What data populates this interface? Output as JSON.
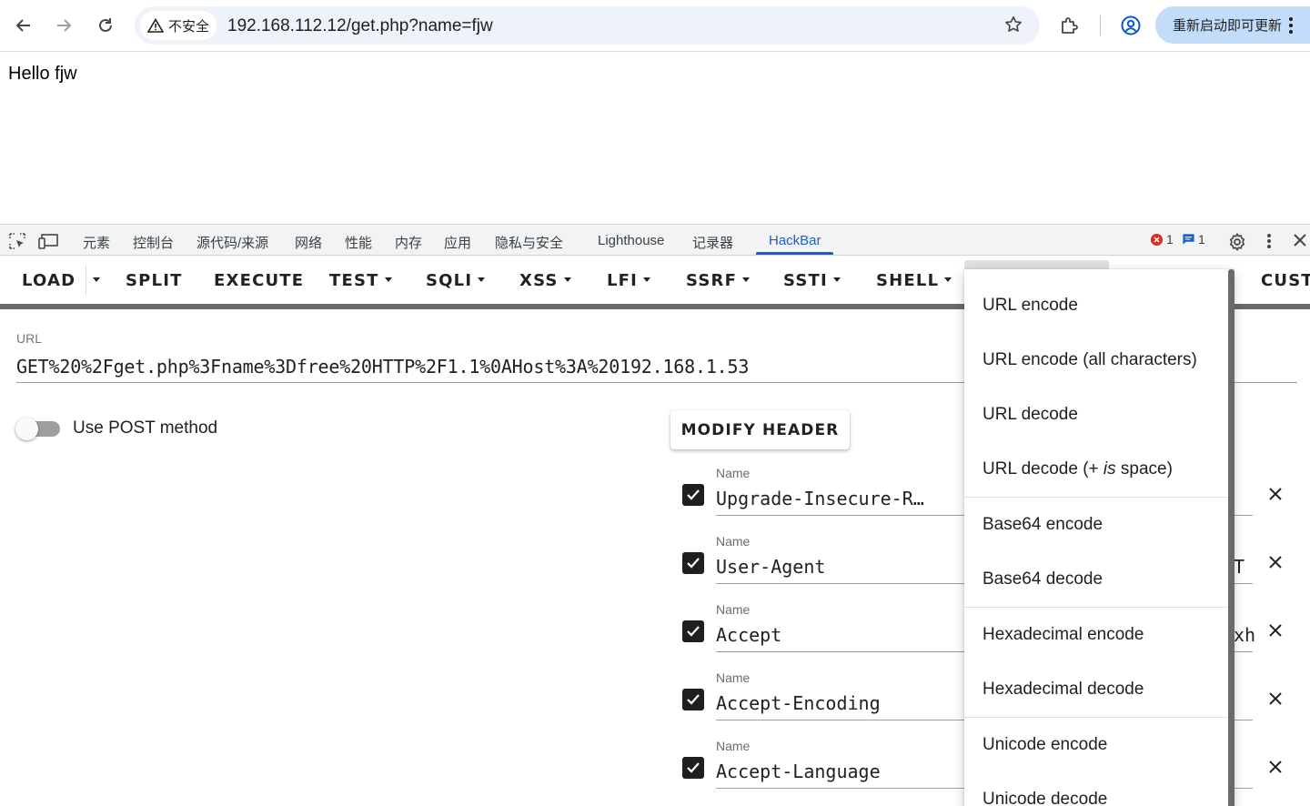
{
  "browser": {
    "security_label": "不安全",
    "url": "192.168.112.12/get.php?name=fjw",
    "update_label": "重新启动即可更新"
  },
  "page": {
    "body_text": "Hello fjw"
  },
  "devtools": {
    "tabs": [
      "元素",
      "控制台",
      "源代码/来源",
      "网络",
      "性能",
      "内存",
      "应用",
      "隐私与安全",
      "Lighthouse",
      "记录器",
      "HackBar"
    ],
    "active_tab": "HackBar",
    "error_count": "1",
    "message_count": "1"
  },
  "hackbar": {
    "menu": {
      "load": "LOAD",
      "split": "SPLIT",
      "execute": "EXECUTE",
      "test": "TEST",
      "sqli": "SQLI",
      "xss": "XSS",
      "lfi": "LFI",
      "ssrf": "SSRF",
      "ssti": "SSTI",
      "shell": "SHELL",
      "custom": "CUSTO"
    },
    "url_label": "URL",
    "url_value": "GET%20%2Fget.php%3Fname%3Dfree%20HTTP%2F1.1%0AHost%3A%20192.168.1.53",
    "post_label": "Use POST method",
    "post_enabled": false,
    "modify_header_label": "MODIFY HEADER",
    "headers": [
      {
        "label": "Name",
        "name": "Upgrade-Insecure-R…",
        "checked": true,
        "value_peek": ""
      },
      {
        "label": "Name",
        "name": "User-Agent",
        "checked": true,
        "value_peek": "T"
      },
      {
        "label": "Name",
        "name": "Accept",
        "checked": true,
        "value_peek": "xh"
      },
      {
        "label": "Name",
        "name": "Accept-Encoding",
        "checked": true,
        "value_peek": ""
      },
      {
        "label": "Name",
        "name": "Accept-Language",
        "checked": true,
        "value_peek": ""
      }
    ],
    "encoding_dropdown": {
      "items": {
        "url_encode": "URL encode",
        "url_encode_all": "URL encode (all characters)",
        "url_decode": "URL decode",
        "url_decode_plus_a": "URL decode (+ ",
        "url_decode_plus_is": "is",
        "url_decode_plus_b": " space)",
        "base64_encode": "Base64 encode",
        "base64_decode": "Base64 decode",
        "hex_encode": "Hexadecimal encode",
        "hex_decode": "Hexadecimal decode",
        "unicode_encode": "Unicode encode",
        "unicode_decode": "Unicode decode"
      }
    }
  }
}
